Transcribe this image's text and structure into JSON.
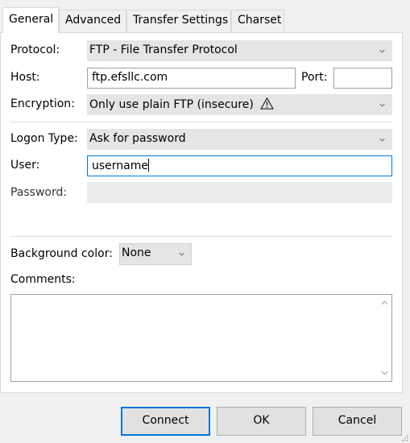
{
  "tabs": [
    {
      "label": "General",
      "active": true
    },
    {
      "label": "Advanced",
      "active": false
    },
    {
      "label": "Transfer Settings",
      "active": false
    },
    {
      "label": "Charset",
      "active": false
    }
  ],
  "protocol": {
    "label": "Protocol:",
    "value": "FTP - File Transfer Protocol"
  },
  "host": {
    "label": "Host:",
    "value": "ftp.efsllc.com"
  },
  "port": {
    "label": "Port:",
    "value": ""
  },
  "encryption": {
    "label": "Encryption:",
    "value": "Only use plain FTP (insecure)",
    "icon": "warning-icon"
  },
  "logon_type": {
    "label": "Logon Type:",
    "value": "Ask for password"
  },
  "user": {
    "label": "User:",
    "value": "username"
  },
  "password": {
    "label": "Password:",
    "value": ""
  },
  "background_color": {
    "label": "Background color:",
    "value": "None"
  },
  "comments": {
    "label": "Comments:",
    "value": ""
  },
  "buttons": {
    "connect": "Connect",
    "ok": "OK",
    "cancel": "Cancel"
  },
  "colors": {
    "accent": "#0078d7",
    "combo_bg": "#e5e5e5",
    "window_bg": "#f0f0f0"
  }
}
